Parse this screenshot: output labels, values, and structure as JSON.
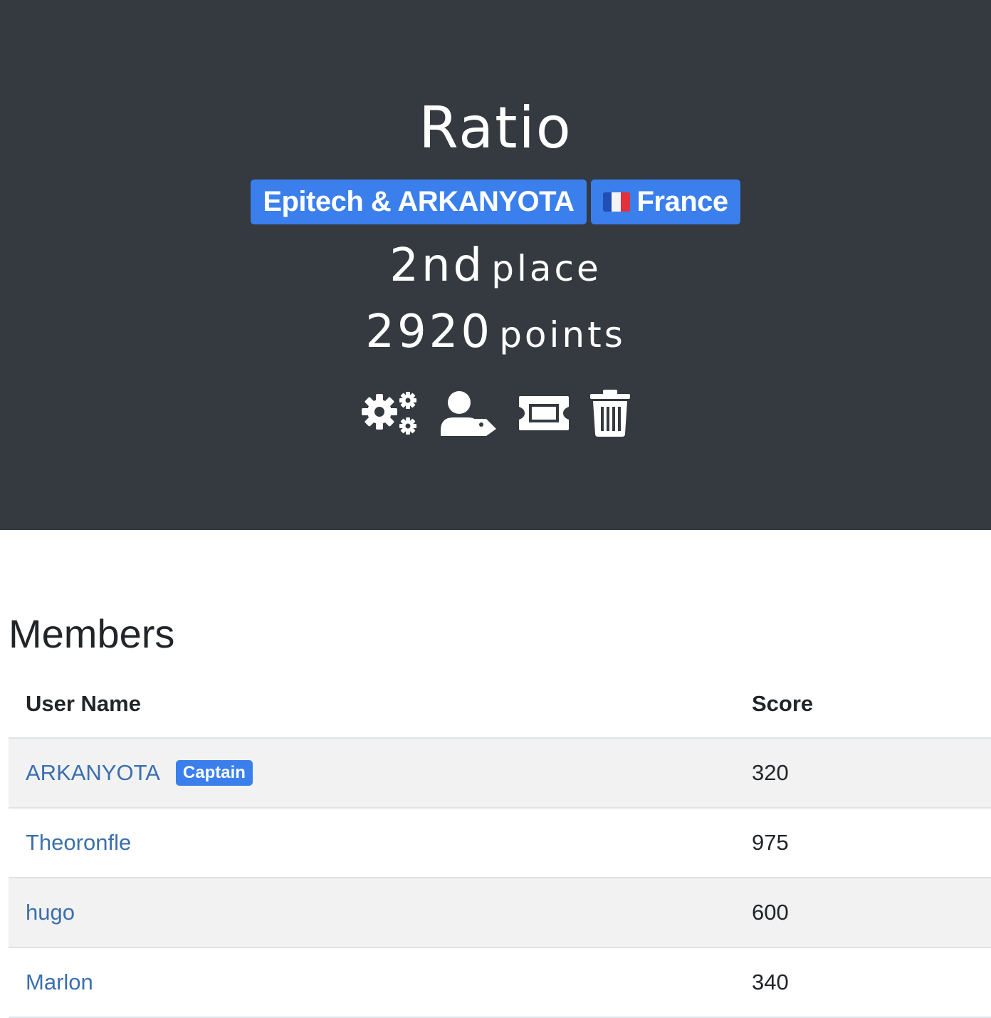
{
  "team": {
    "name": "Ratio",
    "affiliation": "Epitech & ARKANYOTA",
    "country": "France",
    "place_number": "2nd",
    "place_label": "place",
    "points_value": "2920",
    "points_label": "points"
  },
  "actions": [
    {
      "icon": "gears-icon"
    },
    {
      "icon": "user-tag-icon"
    },
    {
      "icon": "ticket-icon"
    },
    {
      "icon": "trash-icon"
    }
  ],
  "members": {
    "title": "Members",
    "headers": {
      "name": "User Name",
      "score": "Score"
    },
    "rows": [
      {
        "name": "ARKANYOTA",
        "badge": "Captain",
        "score": "320"
      },
      {
        "name": "Theoronfle",
        "score": "975"
      },
      {
        "name": "hugo",
        "score": "600"
      },
      {
        "name": "Marlon",
        "score": "340"
      }
    ]
  },
  "colors": {
    "header_bg": "#343a40",
    "badge_blue": "#3a7fec",
    "link": "#3a6fae",
    "stripe": "#f2f2f2"
  }
}
